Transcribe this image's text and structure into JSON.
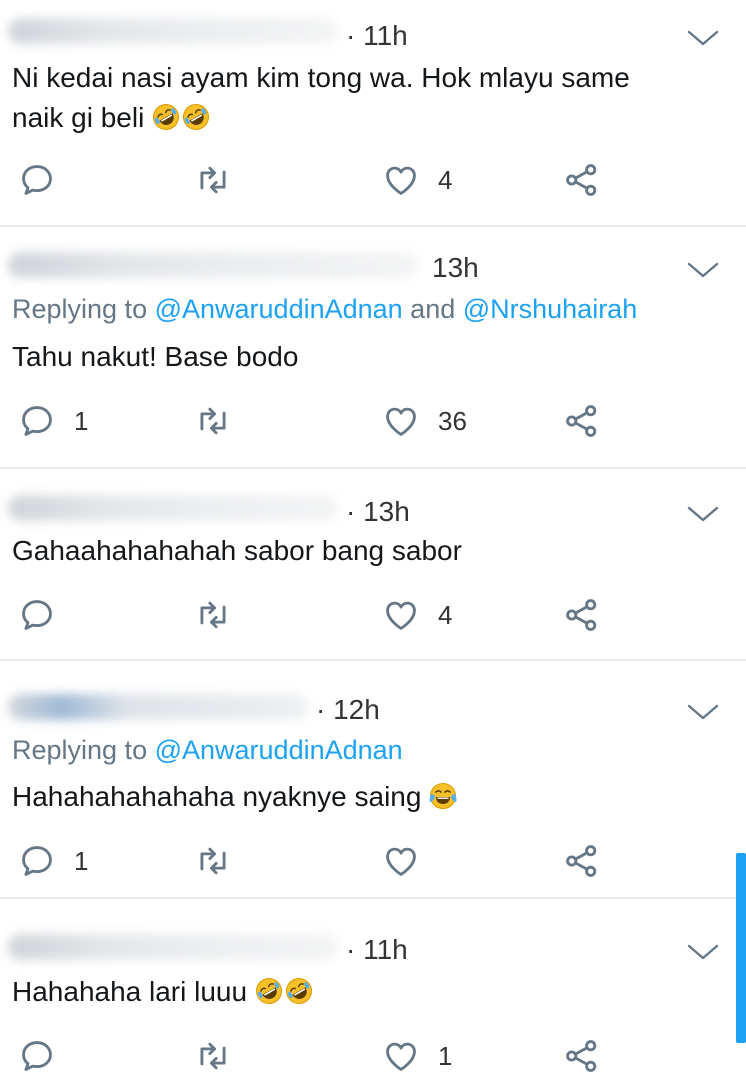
{
  "colors": {
    "accent": "#1da1f2",
    "muted": "#657786",
    "icon": "#657786"
  },
  "icons": {
    "reply": "reply-icon",
    "retweet": "retweet-icon",
    "like": "heart-icon",
    "share": "share-icon",
    "more": "chevron-down-icon",
    "emoji_rofl": "rolling-on-floor-laughing-emoji",
    "emoji_joy": "face-with-tears-of-joy-emoji"
  },
  "tweets": [
    {
      "time": "· 11h",
      "line1": "Ni kedai nasi ayam kim tong wa. Hok mlayu same",
      "line2": "naik gi beli",
      "emojis": 2,
      "emoji_type": "rofl",
      "replies": "",
      "likes": "4"
    },
    {
      "time": "13h",
      "replying_prefix": "Replying to ",
      "replying_to": "@AnwaruddinAdnan",
      "replying_and": " and ",
      "replying_to2": "@Nrshuhairah",
      "line1": "Tahu nakut! Base bodo",
      "replies": "1",
      "likes": "36"
    },
    {
      "time": "· 13h",
      "line1": "Gahaahahahahah sabor bang sabor",
      "replies": "",
      "likes": "4"
    },
    {
      "time": "· 12h",
      "replying_prefix": "Replying to ",
      "replying_to": "@AnwaruddinAdnan",
      "line1": "Hahahahahahaha nyaknye saing",
      "emojis": 1,
      "emoji_type": "joy",
      "replies": "1",
      "likes": ""
    },
    {
      "time": "· 11h",
      "line1": "Hahahaha lari luuu",
      "emojis": 2,
      "emoji_type": "rofl",
      "replies": "",
      "likes": "1"
    }
  ]
}
